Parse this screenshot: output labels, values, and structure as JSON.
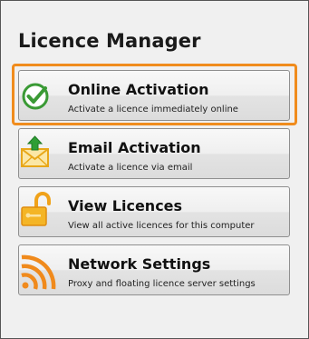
{
  "window": {
    "title": "Licence Manager"
  },
  "buttons": [
    {
      "label": "Online Activation",
      "description": "Activate a licence immediately online",
      "icon": "check-circle-icon",
      "focused": true
    },
    {
      "label": "Email Activation",
      "description": "Activate a licence via email",
      "icon": "envelope-upload-icon"
    },
    {
      "label": "View Licences",
      "description": "View all active licences for this computer",
      "icon": "unlock-icon"
    },
    {
      "label": "Network Settings",
      "description": "Proxy and floating licence server settings",
      "icon": "network-signal-icon"
    }
  ],
  "colors": {
    "focus_ring": "#f08c1d",
    "check_green": "#3a9a35",
    "upload_green": "#2f9e35",
    "envelope_yellow": "#f4c12a",
    "lock_orange": "#f0a21a",
    "signal_orange": "#f08a1c"
  }
}
